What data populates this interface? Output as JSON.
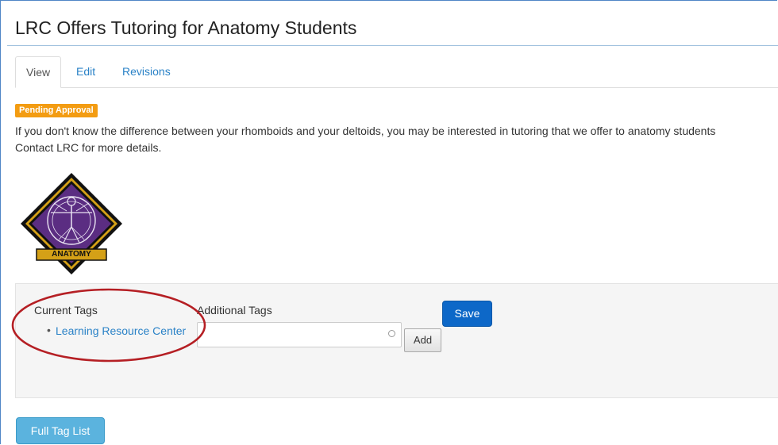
{
  "page": {
    "title": "LRC Offers Tutoring for Anatomy Students"
  },
  "tabs": [
    {
      "label": "View",
      "active": true
    },
    {
      "label": "Edit",
      "active": false
    },
    {
      "label": "Revisions",
      "active": false
    }
  ],
  "status_badge": "Pending Approval",
  "body": {
    "line1": "If you don't know the difference between your rhomboids and your deltoids, you may be interested in tutoring that we offer to anatomy students",
    "line2": "Contact LRC for more details."
  },
  "logo": {
    "label": "ANATOMY",
    "colors": {
      "diamond": "#5b2d82",
      "border": "#111111",
      "banner": "#d4a017"
    }
  },
  "tags": {
    "current_label": "Current Tags",
    "current_items": [
      "Learning Resource Center"
    ],
    "additional_label": "Additional Tags",
    "input_value": "",
    "add_button": "Add",
    "save_button": "Save"
  },
  "full_tag_list_button": "Full Tag List",
  "colors": {
    "link": "#2a82c7",
    "badge": "#f39c12",
    "save": "#0d68c8",
    "full_tag_list": "#5bb3de",
    "annotation": "#b51f24"
  }
}
